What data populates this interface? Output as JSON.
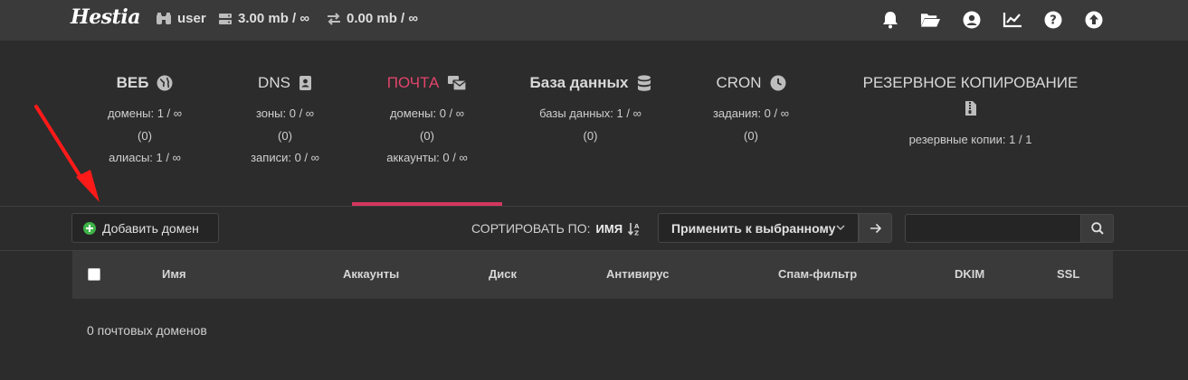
{
  "header": {
    "logo": "Hestia",
    "user": "user",
    "disk": "3.00 mb / ∞",
    "bandwidth": "0.00 mb / ∞",
    "icons": [
      "bell-icon",
      "folder-open-icon",
      "user-circle-icon",
      "chart-line-icon",
      "question-icon",
      "upload-circle-icon"
    ]
  },
  "tabs": [
    {
      "key": "web",
      "title": "ВЕБ",
      "icon": "globe-icon",
      "lines": [
        "домены: 1 / ∞",
        "(0)",
        "алиасы: 1 / ∞"
      ],
      "active": false
    },
    {
      "key": "dns",
      "title": "DNS",
      "icon": "address-book-icon",
      "lines": [
        "зоны: 0 / ∞",
        "(0)",
        "записи: 0 / ∞"
      ],
      "active": false
    },
    {
      "key": "mail",
      "title": "ПОЧТА",
      "icon": "mail-bulk-icon",
      "lines": [
        "домены: 0 / ∞",
        "(0)",
        "аккаунты: 0 / ∞"
      ],
      "active": true
    },
    {
      "key": "db",
      "title": "База данных",
      "icon": "database-icon",
      "lines": [
        "базы данных: 1 / ∞",
        "(0)"
      ],
      "active": false
    },
    {
      "key": "cron",
      "title": "CRON",
      "icon": "clock-icon",
      "lines": [
        "задания: 0 / ∞",
        "(0)"
      ],
      "active": false
    },
    {
      "key": "backup",
      "title": "РЕЗЕРВНОЕ КОПИРОВАНИЕ",
      "icon": "file-archive-icon",
      "lines": [
        "резервные копии: 1 / 1"
      ],
      "active": false
    }
  ],
  "toolbar": {
    "add_label": "Добавить домен",
    "sort_label": "СОРТИРОВАТЬ ПО:",
    "sort_value": "ИМЯ",
    "bulk_label": "Применить к выбранному",
    "search_placeholder": ""
  },
  "table": {
    "columns": [
      "Имя",
      "Аккаунты",
      "Диск",
      "Антивирус",
      "Спам-фильтр",
      "DKIM",
      "SSL"
    ],
    "empty_text": "0 почтовых доменов"
  },
  "colors": {
    "accent": "#e2446a",
    "background": "#2c2c2c",
    "topbar": "#3a3a3a",
    "add_icon": "#3fb449",
    "arrow": "#ff1a1a"
  }
}
